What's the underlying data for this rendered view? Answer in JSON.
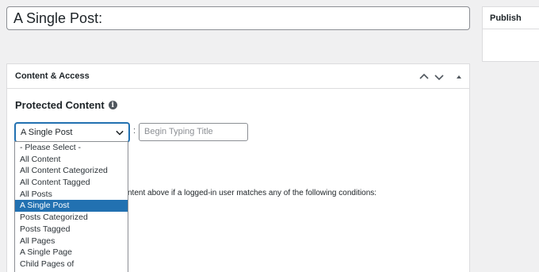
{
  "post_title": "A Single Post:",
  "publish": {
    "title": "Publish"
  },
  "metabox": {
    "title": "Content & Access",
    "icons": [
      "chevron-up-icon",
      "chevron-down-icon",
      "triangle-up-icon"
    ]
  },
  "protected": {
    "label": "Protected Content",
    "info_icon": "i",
    "selected_value": "A Single Post",
    "colon": ":",
    "title_placeholder": "Begin Typing Title"
  },
  "background_text": "ntent above if a logged-in user matches any of the following conditions:",
  "dropdown": {
    "options": [
      "- Please Select -",
      "All Content",
      "All Content Categorized",
      "All Content Tagged",
      "All Posts",
      "A Single Post",
      "Posts Categorized",
      "Posts Tagged",
      "All Pages",
      "A Single Page",
      "Child Pages of"
    ],
    "selected_index": 5
  },
  "colors": {
    "accent": "#2271b1"
  }
}
